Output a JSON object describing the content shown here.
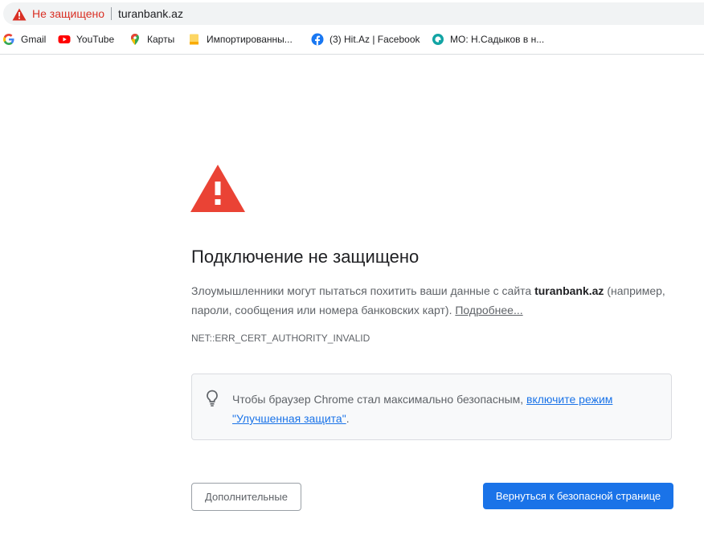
{
  "omnibox": {
    "security_label": "Не защищено",
    "security_icon": "warning-triangle-icon",
    "url": "turanbank.az"
  },
  "bookmarks": [
    {
      "label": "Gmail",
      "icon": "google-icon"
    },
    {
      "label": "YouTube",
      "icon": "youtube-icon"
    },
    {
      "label": "Карты",
      "icon": "maps-pin-icon"
    },
    {
      "label": "Импортированны...",
      "icon": "folder-icon"
    },
    {
      "label": "(3) Hit.Az | Facebook",
      "icon": "facebook-icon"
    },
    {
      "label": "МО: Н.Садыков в н...",
      "icon": "site-icon"
    }
  ],
  "interstitial": {
    "title": "Подключение не защищено",
    "description_prefix": "Злоумышленники могут пытаться похитить ваши данные с сайта ",
    "description_site": "turanbank.az",
    "description_suffix": " (например, пароли, сообщения или номера банковских карт). ",
    "learn_more": "Подробнее...",
    "error_code": "NET::ERR_CERT_AUTHORITY_INVALID",
    "tip_prefix": "Чтобы браузер Chrome стал максимально безопасным, ",
    "tip_link": "включите режим \"Улучшенная защита\"",
    "tip_suffix": ".",
    "advanced_button": "Дополнительные",
    "back_button": "Вернуться к безопасной странице"
  },
  "colors": {
    "warning_red": "#ea4335",
    "primary_blue": "#1a73e8",
    "not_secure_red": "#d93025"
  }
}
